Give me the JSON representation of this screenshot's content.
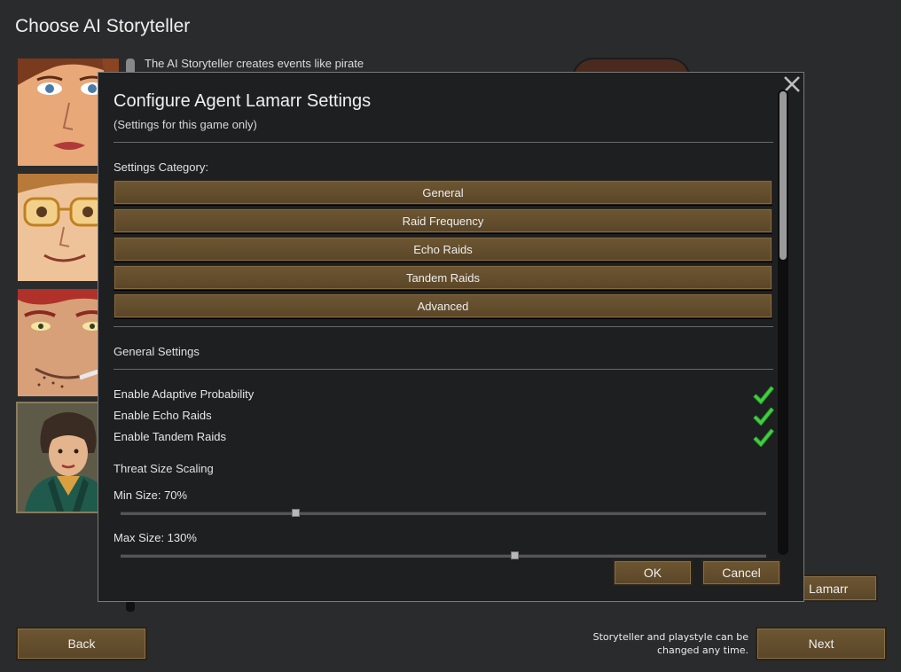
{
  "page": {
    "title": "Choose AI Storyteller",
    "intro_text": "The AI Storyteller creates events like pirate"
  },
  "footer": {
    "back_label": "Back",
    "next_label": "Next",
    "hint_line1": "Storyteller and playstyle can be",
    "hint_line2": "changed any time.",
    "lamarr_label": "Lamarr"
  },
  "dialog": {
    "title": "Configure Agent Lamarr Settings",
    "subtitle": "(Settings for this game only)",
    "category_label": "Settings Category:",
    "categories": [
      "General",
      "Raid Frequency",
      "Echo Raids",
      "Tandem Raids",
      "Advanced"
    ],
    "section_title": "General Settings",
    "options": [
      {
        "label": "Enable Adaptive Probability",
        "checked": true
      },
      {
        "label": "Enable Echo Raids",
        "checked": true
      },
      {
        "label": "Enable Tandem Raids",
        "checked": true
      }
    ],
    "threat_label": "Threat Size Scaling",
    "sliders": [
      {
        "label": "Min Size: 70%",
        "fraction": 0.27
      },
      {
        "label": "Max Size: 130%",
        "fraction": 0.61
      }
    ],
    "ok_label": "OK",
    "cancel_label": "Cancel",
    "close_icon": "close-icon"
  },
  "colors": {
    "button_brown": "#6d5632",
    "check_green": "#3fd23f",
    "dialog_bg": "#1e1f21"
  }
}
